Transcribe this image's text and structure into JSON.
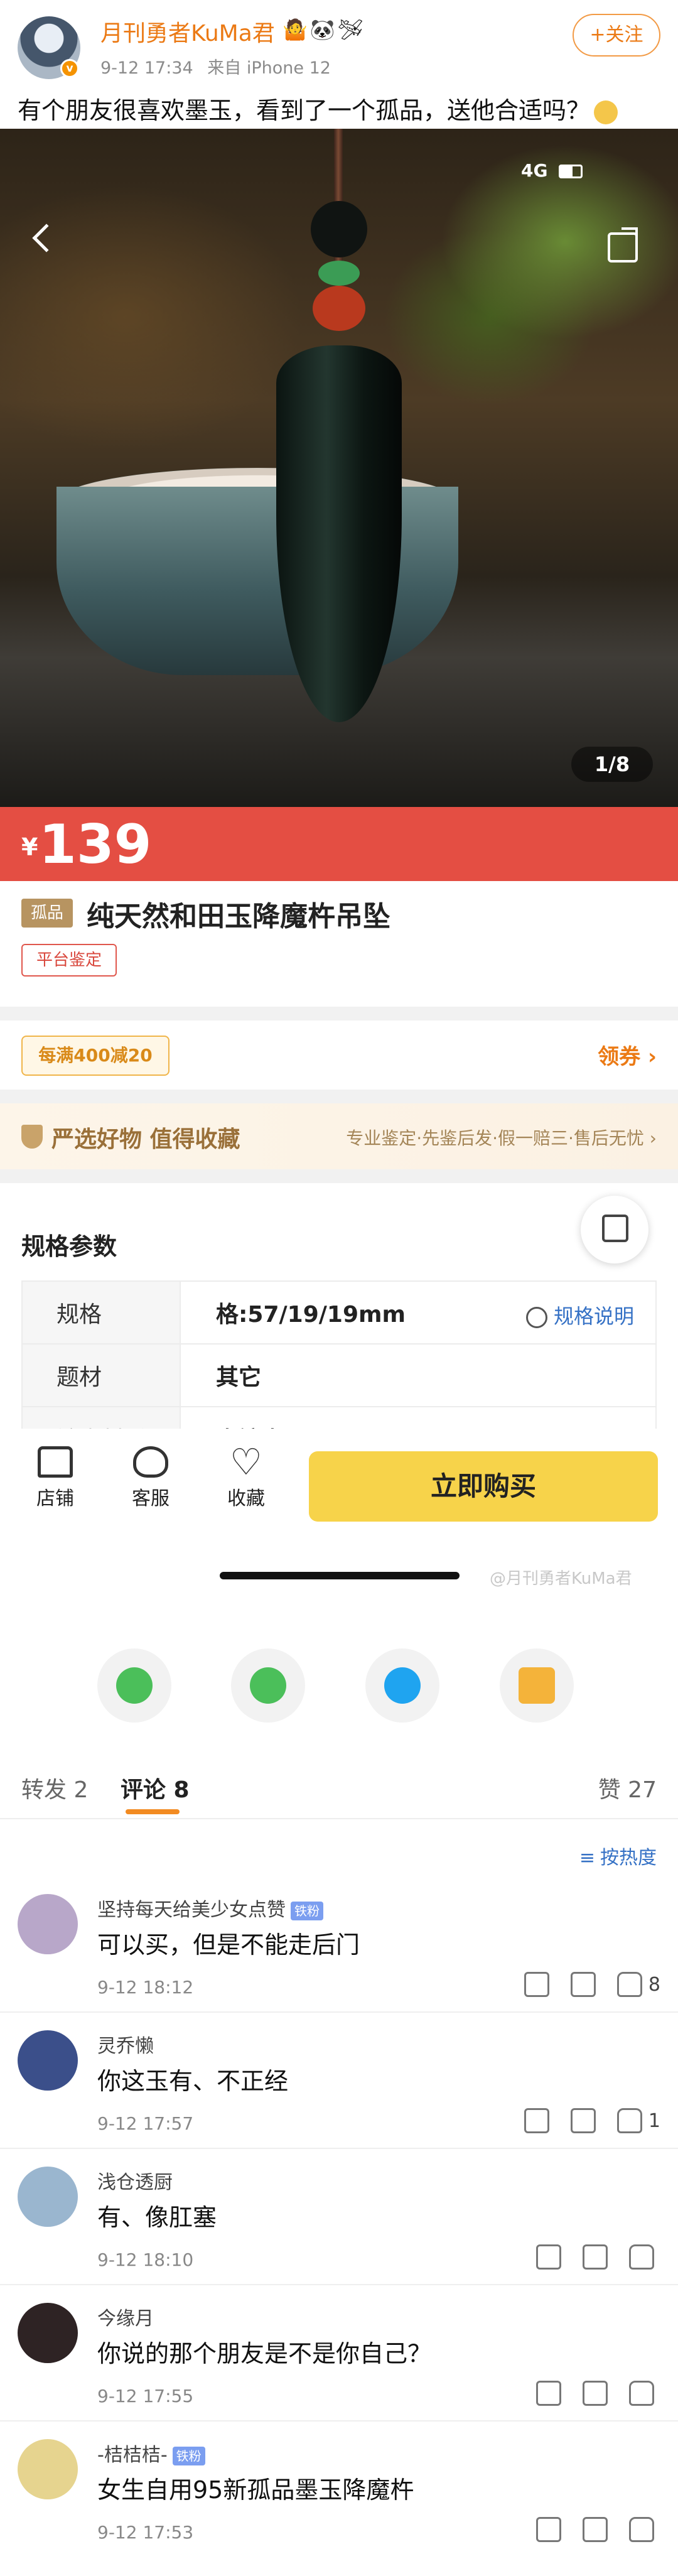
{
  "post": {
    "author": "月刊勇者KuMa君",
    "author_emoji": "🤷🐼🛩",
    "verified_badge": "v",
    "date": "9-12 17:34",
    "source": "来自 iPhone 12",
    "follow_label": "+关注",
    "text": "有个朋友很喜欢墨玉，看到了一个孤品，送他合适吗？"
  },
  "product": {
    "status_network": "4G",
    "image_counter": "1/8",
    "price_symbol": "¥",
    "price": "139",
    "solo_tag": "孤品",
    "title": "纯天然和田玉降魔杵吊坠",
    "auth_tag": "平台鉴定",
    "coupon_tag": "每满400减20",
    "coupon_link": "领券 ›",
    "select_title": "严选好物 值得收藏",
    "select_desc": "专业鉴定·先鉴后发·假一赔三·售后无忧 ›",
    "specs_title": "规格参数",
    "specs": [
      {
        "key": "规格",
        "value": "格:57/19/19mm"
      },
      {
        "key": "题材",
        "value": "其它"
      },
      {
        "key": "镶嵌材质",
        "value": "未镶嵌"
      }
    ],
    "spec_help": "规格说明",
    "bottom": {
      "shop": "店铺",
      "service": "客服",
      "favorite": "收藏",
      "buy": "立即购买"
    },
    "watermark": "@月刊勇者KuMa君"
  },
  "tabs": {
    "repost": "转发 2",
    "comment": "评论 8",
    "like": "赞 27",
    "sort": "按热度"
  },
  "comments": [
    {
      "name": "坚持每天给美少女点赞",
      "badge": "铁粉",
      "text": "可以买，但是不能走后门",
      "time": "9-12 18:12",
      "likes": "8"
    },
    {
      "name": "灵乔懒",
      "badge": "",
      "text": "你这玉有、不正经",
      "time": "9-12 17:57",
      "likes": "1"
    },
    {
      "name": "浅仓透厨",
      "badge": "",
      "text": "有、像肛塞",
      "time": "9-12 18:10",
      "likes": ""
    },
    {
      "name": "今缘月",
      "badge": "",
      "text": "你说的那个朋友是不是你自己？",
      "time": "9-12 17:55",
      "likes": ""
    },
    {
      "name": "-桔桔桔-",
      "badge": "铁粉",
      "text": "女生自用95新孤品墨玉降魔杵",
      "time": "9-12 17:53",
      "likes": ""
    }
  ],
  "colors": {
    "accent": "#eb7a15",
    "price_red": "#e44e43",
    "buy_yellow": "#f7d34a",
    "link_blue": "#3571c5"
  }
}
